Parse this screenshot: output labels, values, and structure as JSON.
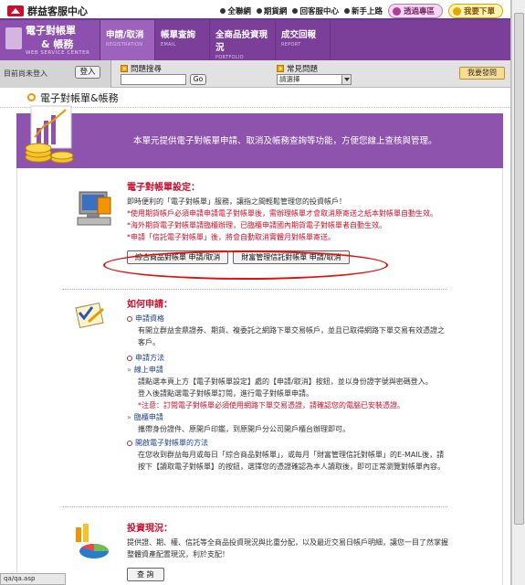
{
  "topbar": {
    "logo_text": "群益客服中心",
    "links": [
      "全聯網",
      "期貨網",
      "回客服中心",
      "新手上路"
    ],
    "pill_left": "透過專區",
    "pill_right": "我要下單"
  },
  "nav": {
    "brand_line1": "電子對帳單",
    "brand_line2": "& 帳務",
    "brand_sub": "WEB SERVICE CENTER",
    "tabs": [
      {
        "label": "申請/取消",
        "sub": "REGISTRATION"
      },
      {
        "label": "帳單查詢",
        "sub": "EMAIL"
      },
      {
        "label": "全商品投資現況",
        "sub": "PORTFOLIO"
      },
      {
        "label": "成交回報",
        "sub": "REPORT"
      }
    ]
  },
  "search": {
    "login_label": "目前尚未登入",
    "login_button": "登入",
    "q1_label": "問題搜尋",
    "go_button": "Go",
    "q2_label": "常見問題",
    "q2_selected": "請選擇",
    "ask_button": "我要發問"
  },
  "page_title": "電子對帳單&帳務",
  "banner_text": "本單元提供電子對帳單申請、取消及帳務查詢等功能，方便您線上查核與管理。",
  "section1": {
    "title": "電子對帳單設定：",
    "intro": "即時便利的「電子對帳單」服務，讓指之間輕鬆管理您的投資帳戶！",
    "notes": [
      "*使用期貨帳戶必須申請申請電子對帳單後，需辦理帳單才會取消原寄送之紙本對帳單自動生效。",
      "*海外期貨電子對帳單請臨櫃辦理，已臨櫃申請國內期貨電子對帳單者自動生效。",
      "*申請「信託電子對帳單」後，將會自動取消實體月對帳單寄送。"
    ],
    "btn1": "綜合商品對帳單 申請/取消",
    "btn2": "財富管理信託對帳單 申請/取消"
  },
  "section2": {
    "title": "如何申請：",
    "h_qual": "申請資格",
    "qual_lines": [
      "有開立群益金鼎證券、期貨、複委託之網路下單交易帳戶，並且已取得網路下單交易有效憑證之",
      "客戶。"
    ],
    "h_method": "申請方法",
    "online_label": "線上申請",
    "online_lines": [
      "請點選本頁上方【電子對帳單設定】處的【申請/取消】按鈕，並以身份證字號與密碼登入。",
      "登入後請點選電子對帳單訂閱，進行電子對帳單申請。"
    ],
    "online_note": "*注意：訂閱電子對帳單必須使用網路下單交易憑證，請確認您的電腦已安裝憑證。",
    "counter_label": "臨櫃申請",
    "counter_line": "攜帶身份證件、原開戶印鑑，到原開戶分公司開戶櫃台辦理即可。",
    "h_open": "開啟電子對帳單的方法",
    "open_lines": [
      "在您收到群益每月或每日「綜合商品對帳單」，或每月「財富管理信託對帳單」的E-MAIL後，請",
      "按下【讀取電子對帳單】的按鈕，選擇您的憑證確認為本人讀取後，即可正常瀏覽對帳單內容。"
    ]
  },
  "section3": {
    "title": "投資現況：",
    "lines": [
      "提供證、期、權、信託等全商品投資現況與比重分配，以及最近交易日帳戶明細，讓您一目了然掌握",
      "整體資產配置現況，利於支配！"
    ],
    "button": "查 詢"
  },
  "status_text": "qa/qa.asp",
  "colors": {
    "purple": "#7b3f9a",
    "red": "#c8102e",
    "orange": "#f29400"
  }
}
